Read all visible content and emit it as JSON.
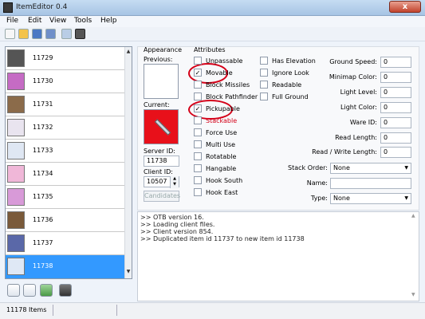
{
  "window": {
    "title": "ItemEditor 0.4",
    "close_glyph": "x"
  },
  "menu": [
    "File",
    "Edit",
    "View",
    "Tools",
    "Help"
  ],
  "toolbar": {
    "icons": [
      "new-icon",
      "open-icon",
      "save-icon",
      "save-as-icon",
      "compare-icon",
      "find-icon"
    ]
  },
  "items": [
    {
      "id": "11729",
      "icon": "helmet-icon"
    },
    {
      "id": "11730",
      "icon": "wand-icon"
    },
    {
      "id": "11731",
      "icon": "rod-icon"
    },
    {
      "id": "11732",
      "icon": "potion-icon"
    },
    {
      "id": "11733",
      "icon": "flask-icon"
    },
    {
      "id": "11734",
      "icon": "potion-pink-icon"
    },
    {
      "id": "11735",
      "icon": "potion-purple-icon"
    },
    {
      "id": "11736",
      "icon": "bottle-icon"
    },
    {
      "id": "11737",
      "icon": "book-icon"
    },
    {
      "id": "11738",
      "icon": "wand-icon",
      "selected": true
    }
  ],
  "appearance": {
    "header": "Appearance",
    "previous_label": "Previous:",
    "current_label": "Current:",
    "server_id_label": "Server ID:",
    "server_id_value": "11738",
    "client_id_label": "Client ID:",
    "client_id_value": "10507",
    "candidates_label": "Candidates"
  },
  "attributes": {
    "header": "Attributes",
    "col1": [
      {
        "label": "Unpassable",
        "checked": false
      },
      {
        "label": "Movable",
        "checked": true
      },
      {
        "label": "Block Missiles",
        "checked": false
      },
      {
        "label": "Block Pathfinder",
        "checked": false
      },
      {
        "label": "Pickupable",
        "checked": true
      },
      {
        "label": "Stackable",
        "checked": false,
        "red": true
      },
      {
        "label": "Force Use",
        "checked": false
      },
      {
        "label": "Multi Use",
        "checked": false
      },
      {
        "label": "Rotatable",
        "checked": false
      },
      {
        "label": "Hangable",
        "checked": false
      },
      {
        "label": "Hook South",
        "checked": false
      },
      {
        "label": "Hook East",
        "checked": false
      }
    ],
    "col2": [
      {
        "label": "Has Elevation",
        "checked": false
      },
      {
        "label": "Ignore Look",
        "checked": false
      },
      {
        "label": "Readable",
        "checked": false
      },
      {
        "label": "Full Ground",
        "checked": false
      }
    ],
    "fields": {
      "ground_speed": {
        "label": "Ground Speed:",
        "value": "0"
      },
      "minimap_color": {
        "label": "Minimap Color:",
        "value": "0"
      },
      "light_level": {
        "label": "Light Level:",
        "value": "0"
      },
      "light_color": {
        "label": "Light Color:",
        "value": "0"
      },
      "ware_id": {
        "label": "Ware ID:",
        "value": "0"
      },
      "read_length": {
        "label": "Read Length:",
        "value": "0"
      },
      "read_write_length": {
        "label": "Read / Write Length:",
        "value": "0"
      },
      "stack_order": {
        "label": "Stack Order:",
        "value": "None"
      },
      "name": {
        "label": "Name:",
        "value": ""
      },
      "type": {
        "label": "Type:",
        "value": "None"
      }
    }
  },
  "log": [
    ">> OTB version 16.",
    ">> Loading client files.",
    ">> Client version 854.",
    ">> Duplicated item id 11737 to new item id 11738"
  ],
  "status": {
    "text": "11178 Items"
  },
  "colors": {
    "accent": "#3399ff",
    "current_sprite_bg": "#e8101a",
    "annotation": "#d40018"
  }
}
